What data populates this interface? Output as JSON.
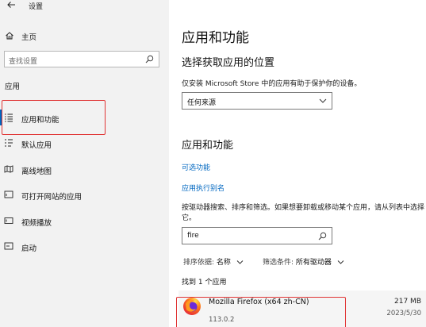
{
  "window": {
    "title": "设置"
  },
  "sidebar": {
    "home_label": "主页",
    "search_placeholder": "查找设置",
    "section_label": "应用",
    "items": [
      {
        "label": "应用和功能",
        "icon": "apps-list-icon",
        "selected": true
      },
      {
        "label": "默认应用",
        "icon": "default-apps-icon"
      },
      {
        "label": "离线地图",
        "icon": "offline-maps-icon"
      },
      {
        "label": "可打开网站的应用",
        "icon": "apps-for-websites-icon"
      },
      {
        "label": "视频播放",
        "icon": "video-playback-icon"
      },
      {
        "label": "启动",
        "icon": "startup-icon"
      }
    ]
  },
  "main": {
    "page_title": "应用和功能",
    "install_source": {
      "heading": "选择获取应用的位置",
      "description": "仅安装 Microsoft Store 中的应用有助于保护你的设备。",
      "selected": "任何来源"
    },
    "apps": {
      "heading": "应用和功能",
      "link_optional": "可选功能",
      "link_aliases": "应用执行别名",
      "description": "按驱动器搜索、排序和筛选。如果想要卸载或移动某个应用，请从列表中选择它。",
      "search_value": "fire",
      "sort_label": "排序依据:",
      "sort_value": "名称",
      "filter_label": "筛选条件:",
      "filter_value": "所有驱动器",
      "found_text": "找到 1 个应用",
      "list": [
        {
          "name": "Mozilla Firefox (x64 zh-CN)",
          "version": "113.0.2",
          "size": "217 MB",
          "date": "2023/5/30"
        }
      ]
    }
  },
  "colors": {
    "accent": "#0067c0",
    "highlight_box": "#e03434",
    "sidebar_bg": "#f2f2f2"
  }
}
